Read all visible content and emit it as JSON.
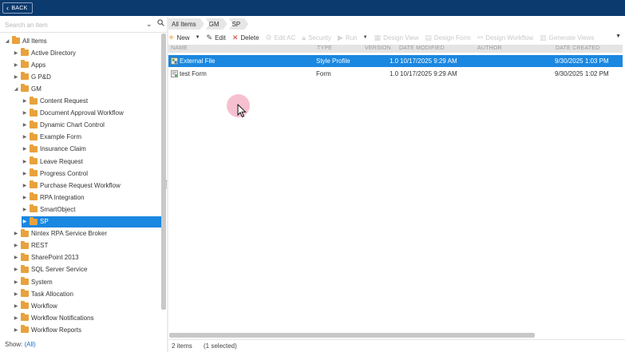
{
  "topbar": {
    "back_label": "BACK"
  },
  "search": {
    "placeholder": "Search an item"
  },
  "tree": [
    {
      "label": "All Items",
      "level": 0,
      "expanded": true
    },
    {
      "label": "Active Directory",
      "level": 1
    },
    {
      "label": "Apps",
      "level": 1
    },
    {
      "label": "G P&D",
      "level": 1
    },
    {
      "label": "GM",
      "level": 1,
      "expanded": true
    },
    {
      "label": "Content Request",
      "level": 2
    },
    {
      "label": "Document Approval Workflow",
      "level": 2
    },
    {
      "label": "Dynamic Chart Control",
      "level": 2
    },
    {
      "label": "Example Form",
      "level": 2
    },
    {
      "label": "Insurance Claim",
      "level": 2
    },
    {
      "label": "Leave Request",
      "level": 2
    },
    {
      "label": "Progress Control",
      "level": 2
    },
    {
      "label": "Purchase Request Workflow",
      "level": 2
    },
    {
      "label": "RPA Integration",
      "level": 2
    },
    {
      "label": "SmartObject",
      "level": 2
    },
    {
      "label": "SP",
      "level": 2,
      "selected": true
    },
    {
      "label": "Nintex RPA Service Broker",
      "level": 1
    },
    {
      "label": "REST",
      "level": 1
    },
    {
      "label": "SharePoint 2013",
      "level": 1
    },
    {
      "label": "SQL Server Service",
      "level": 1
    },
    {
      "label": "System",
      "level": 1
    },
    {
      "label": "Task Allocation",
      "level": 1
    },
    {
      "label": "Workflow",
      "level": 1
    },
    {
      "label": "Workflow Notifications",
      "level": 1
    },
    {
      "label": "Workflow Reports",
      "level": 1
    }
  ],
  "show": {
    "label": "Show:",
    "value": "(All)"
  },
  "breadcrumb": [
    "All Items",
    "GM",
    "SP"
  ],
  "toolbar": {
    "new": "New",
    "edit": "Edit",
    "delete": "Delete",
    "disabled": [
      "Edit AC",
      "Security",
      "Run",
      "Design View",
      "Design Form",
      "Design Workflow",
      "Generate Views"
    ]
  },
  "grid": {
    "columns": [
      "NAME",
      "TYPE",
      "VERSION",
      "DATE MODIFIED",
      "AUTHOR",
      "DATE CREATED"
    ],
    "rows": [
      {
        "name": "External File",
        "type": "Style Profile",
        "version": "1.0",
        "modified": "10/17/2025 9:29 AM",
        "author": "",
        "created": "9/30/2025 1:03 PM",
        "selected": true
      },
      {
        "name": "test Form",
        "type": "Form",
        "version": "1.0",
        "modified": "10/17/2025 9:29 AM",
        "author": "",
        "created": "9/30/2025 1:02 PM",
        "selected": false
      }
    ]
  },
  "status": {
    "count": "2 items",
    "selected": "(1 selected)"
  },
  "colors": {
    "topbar": "#0b3a6e",
    "selection": "#1a87e0",
    "folder": "#e8a23c"
  }
}
